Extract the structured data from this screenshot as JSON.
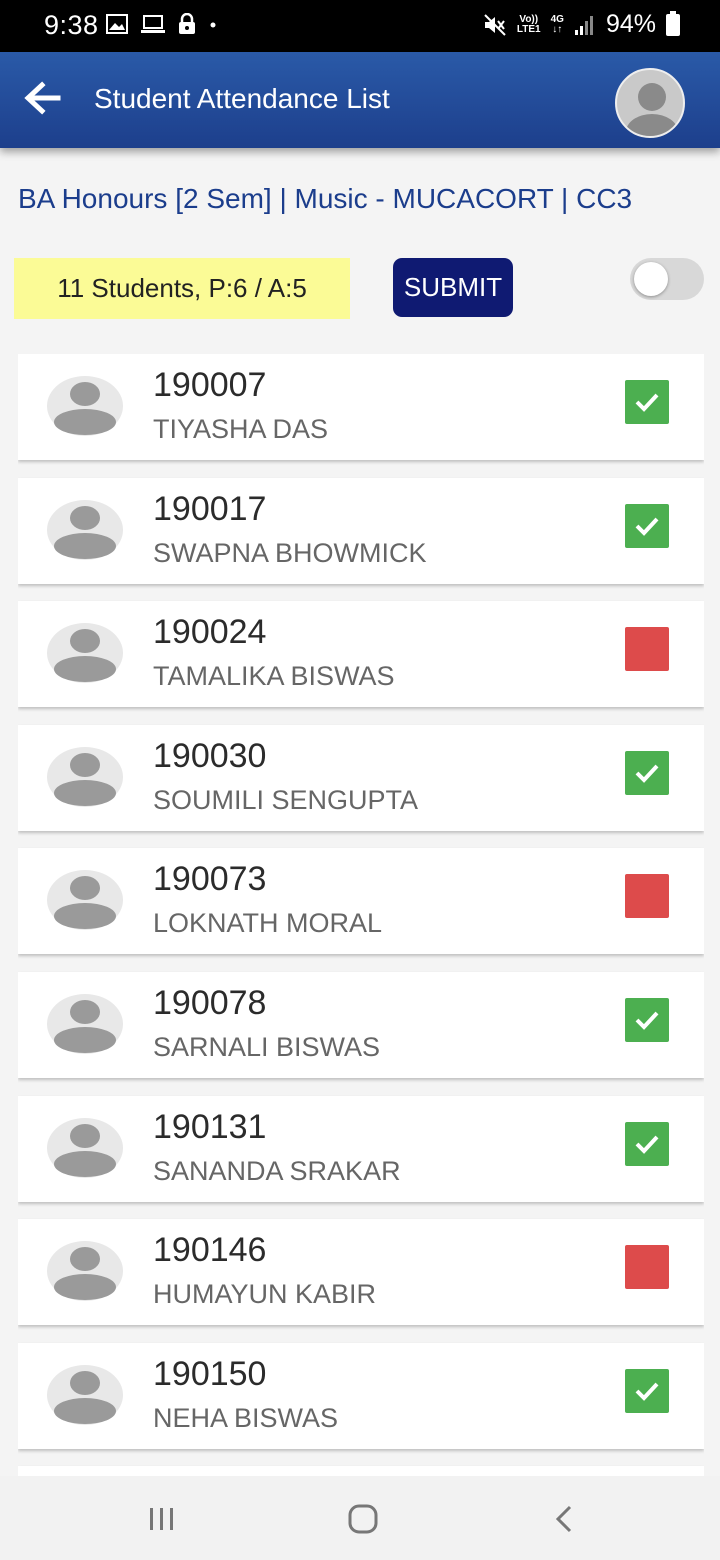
{
  "status_bar": {
    "time": "9:38",
    "battery": "94%",
    "net_top": "Vo))",
    "net_bottom": "LTE1",
    "net_type": "4G",
    "icons": [
      "gallery-icon",
      "laptop-icon",
      "lock-icon",
      "dot-icon",
      "mute-icon",
      "signal-icon",
      "battery-icon"
    ]
  },
  "app_bar": {
    "title": "Student Attendance List",
    "back_icon": "back-arrow-icon",
    "avatar_icon": "profile-avatar-icon"
  },
  "course": "BA Honours [2 Sem] | Music - MUCACORT | CC3",
  "summary": "11 Students, P:6 / A:5",
  "submit_label": "SUBMIT",
  "toggle_on": false,
  "students": [
    {
      "roll": "190007",
      "name": "TIYASHA DAS",
      "present": true
    },
    {
      "roll": "190017",
      "name": "SWAPNA BHOWMICK",
      "present": true
    },
    {
      "roll": "190024",
      "name": "TAMALIKA BISWAS",
      "present": false
    },
    {
      "roll": "190030",
      "name": "SOUMILI SENGUPTA",
      "present": true
    },
    {
      "roll": "190073",
      "name": "LOKNATH MORAL",
      "present": false
    },
    {
      "roll": "190078",
      "name": "SARNALI BISWAS",
      "present": true
    },
    {
      "roll": "190131",
      "name": "SANANDA SRAKAR",
      "present": true
    },
    {
      "roll": "190146",
      "name": "HUMAYUN KABIR",
      "present": false
    },
    {
      "roll": "190150",
      "name": "NEHA BISWAS",
      "present": true
    }
  ],
  "colors": {
    "app_bar": "#1d3f8c",
    "present": "#4caf50",
    "absent": "#dd4b4b",
    "submit": "#0f1a72",
    "summary_bg": "#fbfb96",
    "course_text": "#1b3d8c"
  },
  "nav_bar": {
    "icons": [
      "recent-apps-icon",
      "home-icon",
      "back-icon"
    ]
  }
}
